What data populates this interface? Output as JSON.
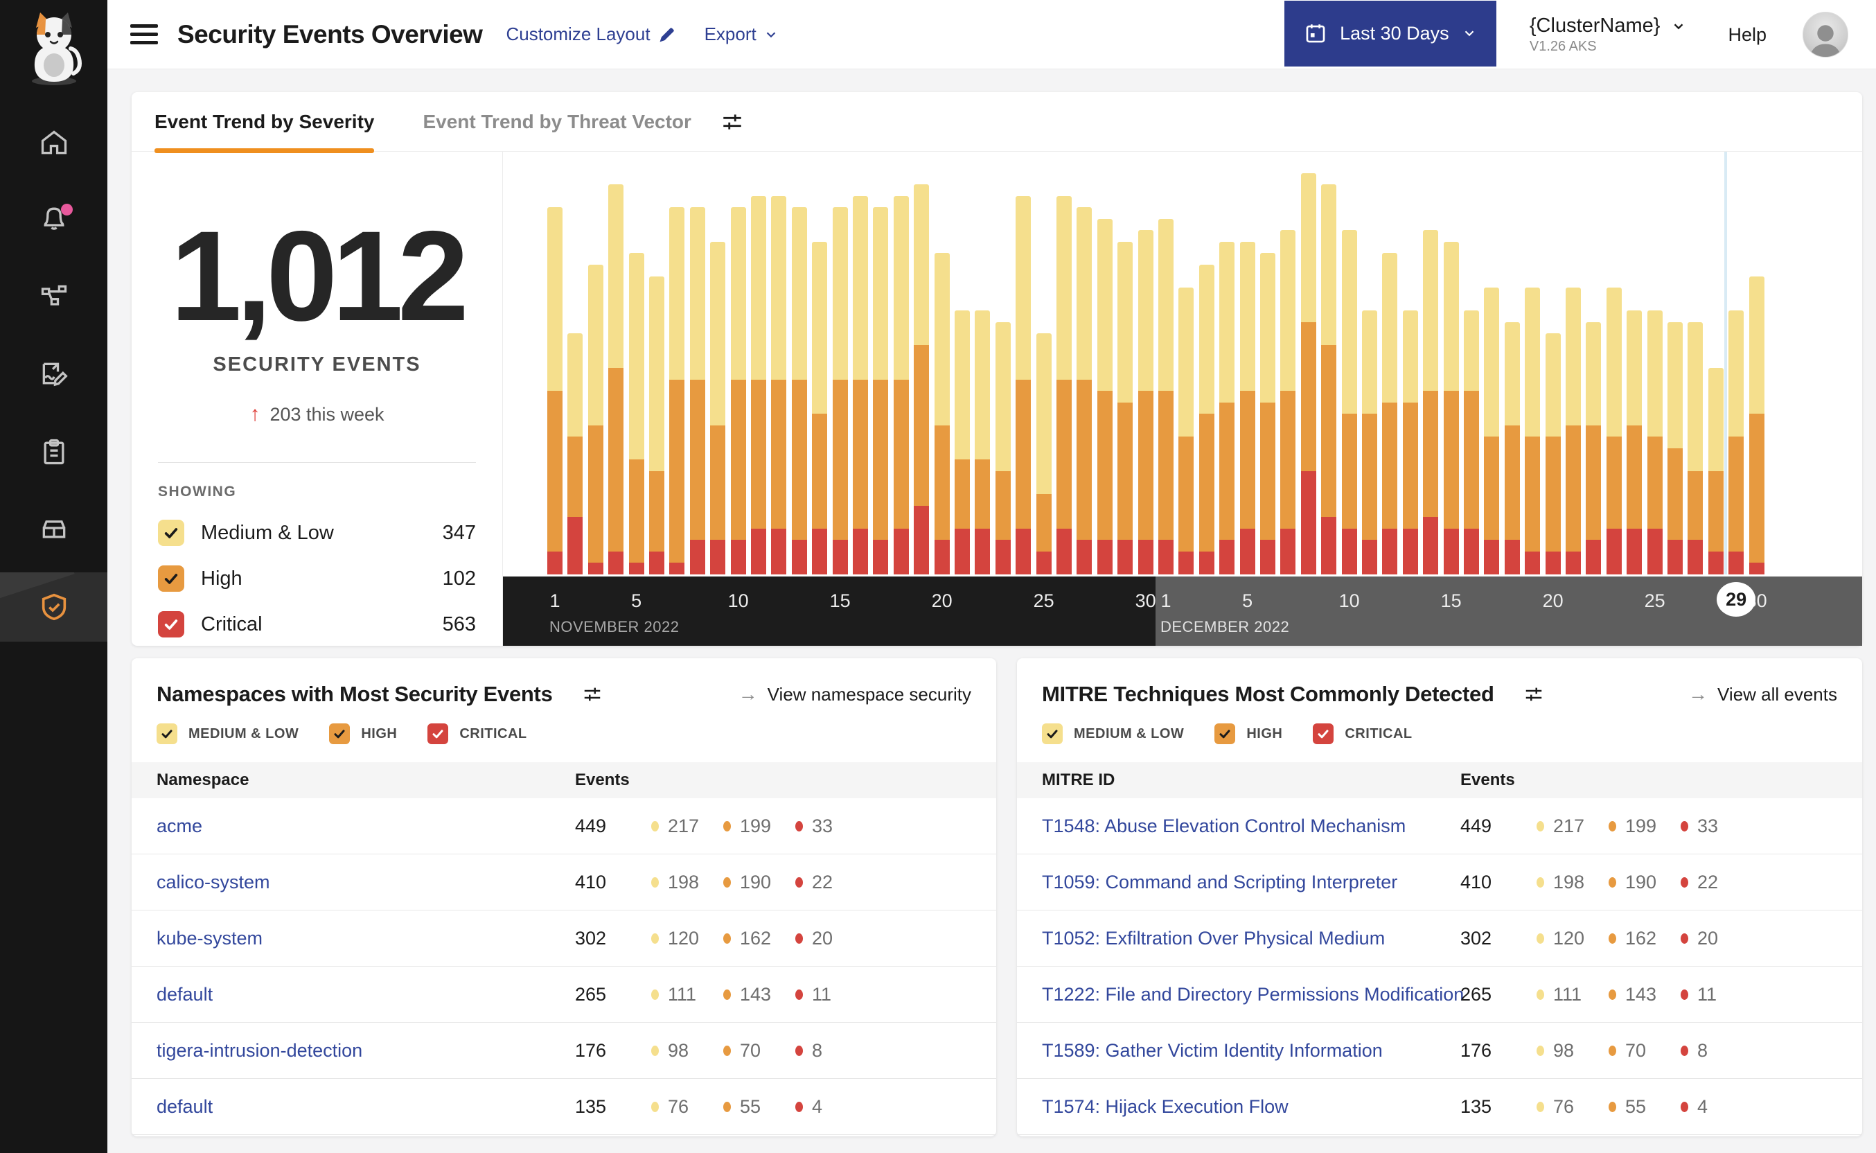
{
  "header": {
    "title": "Security Events Overview",
    "customize_layout": "Customize Layout",
    "export_label": "Export",
    "date_range": "Last 30 Days",
    "cluster_name": "{ClusterName}",
    "cluster_version": "V1.26 AKS",
    "help_label": "Help"
  },
  "sidebar": {
    "items": [
      "home",
      "alerts",
      "service-graph",
      "policies",
      "compliance",
      "workloads",
      "threat-defense"
    ],
    "active_item": "threat-defense",
    "alert_badge_color": "#e8599c",
    "accent_color": "#e8923f"
  },
  "trend_card": {
    "tabs": [
      {
        "label": "Event Trend by Severity",
        "active": true
      },
      {
        "label": "Event Trend by Threat Vector",
        "active": false
      }
    ],
    "total": "1,012",
    "total_label": "SECURITY EVENTS",
    "delta_arrow": "↑",
    "delta": "203 this week",
    "showing_label": "SHOWING",
    "legend": [
      {
        "label": "Medium & Low",
        "count": "347",
        "color": "#f5df8d",
        "check": "#1b1b1b"
      },
      {
        "label": "High",
        "count": "102",
        "color": "#e79a40",
        "check": "#1b1b1b"
      },
      {
        "label": "Critical",
        "count": "563",
        "color": "#d4443e",
        "check": "#ffffff"
      }
    ]
  },
  "chart_data": {
    "type": "bar",
    "stacked": true,
    "grid": false,
    "legend_position": "left-panel",
    "categories": [
      1,
      2,
      3,
      4,
      5,
      6,
      7,
      8,
      9,
      10,
      11,
      12,
      13,
      14,
      15,
      16,
      17,
      18,
      19,
      20,
      21,
      22,
      23,
      24,
      25,
      26,
      27,
      28,
      29,
      30,
      1,
      2,
      3,
      4,
      5,
      6,
      7,
      8,
      9,
      10,
      11,
      12,
      13,
      14,
      15,
      16,
      17,
      18,
      19,
      20,
      21,
      22,
      23,
      24,
      25,
      26,
      27,
      28,
      29,
      30
    ],
    "x_axis": {
      "months": [
        {
          "label": "NOVEMBER 2022",
          "days": 30
        },
        {
          "label": "DECEMBER 2022",
          "days": 30
        }
      ],
      "ticks": [
        1,
        5,
        10,
        15,
        20,
        25,
        30
      ],
      "current_day": {
        "month_index": 1,
        "day": 29
      }
    },
    "series": [
      {
        "name": "Critical",
        "color": "#d4443e",
        "values": [
          2,
          5,
          1,
          2,
          1,
          2,
          1,
          3,
          3,
          3,
          4,
          4,
          3,
          4,
          3,
          4,
          3,
          4,
          6,
          3,
          4,
          4,
          3,
          4,
          2,
          4,
          3,
          3,
          3,
          3,
          3,
          2,
          2,
          3,
          4,
          3,
          4,
          9,
          5,
          4,
          3,
          4,
          4,
          5,
          4,
          4,
          3,
          3,
          2,
          2,
          2,
          3,
          4,
          4,
          4,
          3,
          3,
          2,
          2,
          1
        ]
      },
      {
        "name": "High",
        "color": "#e79a40",
        "values": [
          14,
          7,
          12,
          16,
          9,
          7,
          16,
          14,
          10,
          14,
          13,
          13,
          14,
          10,
          14,
          13,
          14,
          13,
          14,
          10,
          6,
          6,
          6,
          13,
          5,
          13,
          14,
          13,
          12,
          13,
          13,
          10,
          12,
          12,
          12,
          12,
          12,
          13,
          15,
          10,
          11,
          11,
          11,
          11,
          12,
          12,
          9,
          10,
          10,
          10,
          11,
          10,
          8,
          9,
          8,
          8,
          6,
          7,
          10,
          13
        ]
      },
      {
        "name": "Medium & Low",
        "color": "#f5df8d",
        "values": [
          16,
          9,
          14,
          16,
          18,
          17,
          15,
          15,
          16,
          15,
          16,
          16,
          15,
          15,
          15,
          16,
          15,
          16,
          14,
          15,
          13,
          13,
          13,
          16,
          14,
          16,
          15,
          15,
          14,
          14,
          15,
          13,
          13,
          14,
          13,
          13,
          14,
          13,
          14,
          16,
          9,
          13,
          8,
          14,
          13,
          7,
          13,
          9,
          13,
          9,
          12,
          9,
          13,
          10,
          11,
          11,
          13,
          9,
          11,
          12
        ]
      }
    ]
  },
  "filters": [
    {
      "label": "MEDIUM & LOW",
      "color": "#f5df8d",
      "check": "#1b1b1b"
    },
    {
      "label": "HIGH",
      "color": "#e79a40",
      "check": "#1b1b1b"
    },
    {
      "label": "CRITICAL",
      "color": "#d4443e",
      "check": "#ffffff"
    }
  ],
  "namespaces_card": {
    "title": "Namespaces with Most Security Events",
    "link": "View namespace security",
    "columns": [
      "Namespace",
      "Events"
    ],
    "rows": [
      {
        "name": "acme",
        "total": "449",
        "medium_low": "217",
        "high": "199",
        "critical": "33"
      },
      {
        "name": "calico-system",
        "total": "410",
        "medium_low": "198",
        "high": "190",
        "critical": "22"
      },
      {
        "name": "kube-system",
        "total": "302",
        "medium_low": "120",
        "high": "162",
        "critical": "20"
      },
      {
        "name": "default",
        "total": "265",
        "medium_low": "111",
        "high": "143",
        "critical": "11"
      },
      {
        "name": "tigera-intrusion-detection",
        "total": "176",
        "medium_low": "98",
        "high": "70",
        "critical": "8"
      },
      {
        "name": "default",
        "total": "135",
        "medium_low": "76",
        "high": "55",
        "critical": "4"
      }
    ]
  },
  "mitre_card": {
    "title": "MITRE Techniques Most Commonly Detected",
    "link": "View all events",
    "columns": [
      "MITRE ID",
      "Events"
    ],
    "rows": [
      {
        "name": "T1548: Abuse Elevation Control Mechanism",
        "total": "449",
        "medium_low": "217",
        "high": "199",
        "critical": "33"
      },
      {
        "name": "T1059: Command and Scripting Interpreter",
        "total": "410",
        "medium_low": "198",
        "high": "190",
        "critical": "22"
      },
      {
        "name": "T1052: Exfiltration Over Physical Medium",
        "total": "302",
        "medium_low": "120",
        "high": "162",
        "critical": "20"
      },
      {
        "name": "T1222: File and Directory Permissions Modification",
        "total": "265",
        "medium_low": "111",
        "high": "143",
        "critical": "11"
      },
      {
        "name": "T1589: Gather Victim Identity Information",
        "total": "176",
        "medium_low": "98",
        "high": "70",
        "critical": "8"
      },
      {
        "name": "T1574: Hijack Execution Flow",
        "total": "135",
        "medium_low": "76",
        "high": "55",
        "critical": "4"
      }
    ]
  }
}
